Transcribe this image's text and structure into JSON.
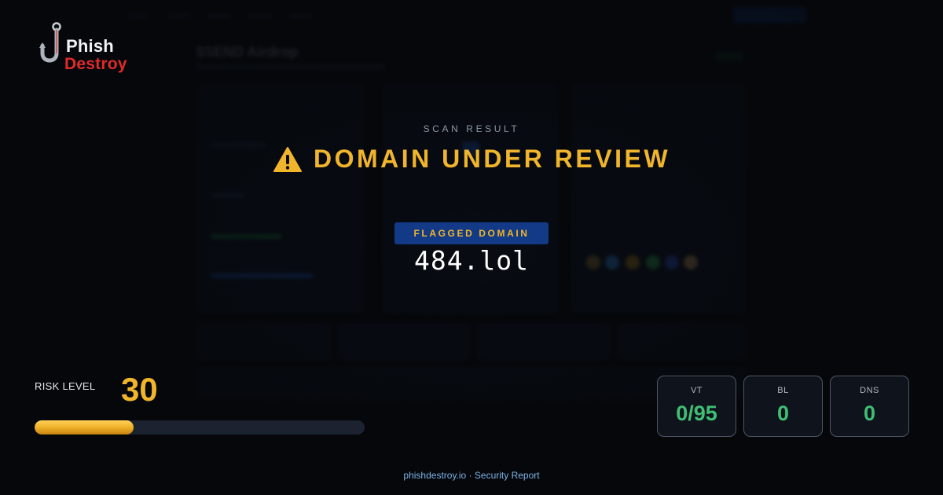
{
  "brand": {
    "name_top": "Phish",
    "name_bottom": "Destroy"
  },
  "scan": {
    "label": "SCAN RESULT",
    "headline": "DOMAIN UNDER REVIEW",
    "flag_label": "FLAGGED DOMAIN",
    "domain": "484.lol"
  },
  "risk": {
    "label": "RISK LEVEL",
    "value": "30",
    "level_fraction": 0.3
  },
  "stats": [
    {
      "label": "VT",
      "value": "0/95"
    },
    {
      "label": "BL",
      "value": "0"
    },
    {
      "label": "DNS",
      "value": "0"
    }
  ],
  "footer": {
    "text": "phishdestroy.io · Security Report"
  },
  "background_site": {
    "title": "$SEND Airdrop"
  },
  "colors": {
    "accent": "#f1b52b",
    "ok": "#3fbf74",
    "danger": "#e22a2a",
    "badge": "#123a86",
    "link": "#7ab4e6"
  }
}
